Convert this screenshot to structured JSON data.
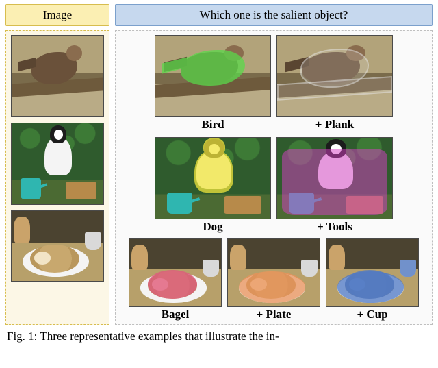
{
  "leftHeader": "Image",
  "rightHeader": "Which one is the salient object?",
  "rows": [
    {
      "source": "bird-on-plank",
      "variants": [
        {
          "label": "Bird"
        },
        {
          "label": "+ Plank"
        }
      ]
    },
    {
      "source": "dog-garden-tools",
      "variants": [
        {
          "label": "Dog"
        },
        {
          "label": "+ Tools"
        }
      ]
    },
    {
      "source": "bagel-plate-cup",
      "variants": [
        {
          "label": "Bagel"
        },
        {
          "label": "+ Plate"
        },
        {
          "label": "+ Cup"
        }
      ]
    }
  ],
  "captionPrefix": "Fig. 1:",
  "captionVisible": "Three representative examples that illustrate the in-"
}
